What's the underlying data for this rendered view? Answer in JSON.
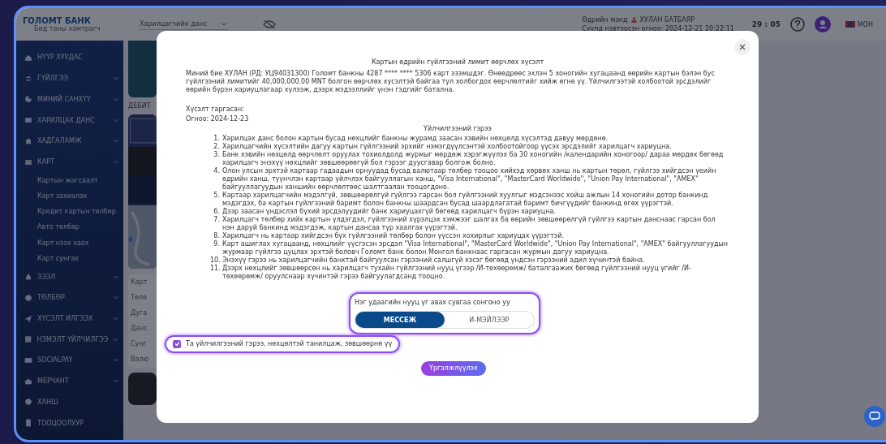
{
  "header": {
    "logo": "ГОЛОМТ БАНК",
    "tagline": "Бид таны хамтрагч",
    "account_select": {
      "placeholder": "Харилцагчийн данс"
    },
    "greeting": "Өдрийн мэнд",
    "user_name": "ХУЛАН БАТБАЯР",
    "last_login": "Сүүлд нэвтэрсэн огноо: 2024-12-21 20:22:11",
    "timer": "29 : 05",
    "language": "МОН"
  },
  "sidebar": {
    "items": [
      {
        "label": "НҮҮР ХУУДАС"
      },
      {
        "label": "ГҮЙЛГЭЭ",
        "expanded": false
      },
      {
        "label": "МИНИЙ САНХҮҮ",
        "expanded": false
      },
      {
        "label": "ХАРИЛЦАХ ДАНС",
        "expanded": false
      },
      {
        "label": "ХАДГАЛАМЖ",
        "expanded": false
      },
      {
        "label": "КАРТ",
        "expanded": true,
        "children": [
          {
            "label": "Картын жагсаалт"
          },
          {
            "label": "Карт захиалах"
          },
          {
            "label": "Кредит картын төлбөр"
          },
          {
            "label": "Авто төлбөр"
          },
          {
            "label": "Карт нээх хаах"
          },
          {
            "label": "Карт сунгах"
          }
        ]
      },
      {
        "label": "ЗЭЭЛ",
        "expanded": false
      },
      {
        "label": "ТӨЛБӨР",
        "expanded": false
      },
      {
        "label": "ХҮСЭЛТ ИЛГЭЭХ",
        "expanded": false
      },
      {
        "label": "НЭМЭЛТ ҮЙЛЧИЛГЭЭ",
        "expanded": false
      },
      {
        "label": "SOCIALPAY",
        "expanded": false
      },
      {
        "label": "МЕРЧАНТ",
        "expanded": false
      },
      {
        "label": "ХАНШ"
      },
      {
        "label": "ТООЦООЛУУР"
      }
    ]
  },
  "content": {
    "section_title": "ДЕБИТ",
    "card_details": [
      "Карт",
      "Төлө",
      "Дуга",
      "Данс",
      "Сунг",
      "Валю"
    ]
  },
  "modal": {
    "title": "Картын өдрийн гүйлгээний лимит өөрчлөх хүсэлт",
    "request_text": "Миний бие ХУЛАН (РД: УЦ94031300) Голомт банкны 4287 **** **** 5306 карт эзэмшдэг. Өнөөдрөөс эхлэн 5 хоногийн хугацаанд өөрийн картын бэлэн бус гүйлгээний лимитийг 40,000,000.00 MNT болгон өөрчлөх хүсэлтэй байгаа тул холбогдох өөрчлөлтийг хийж өгнө үү. Үйлчилгээтэй холбоотой эрсдэлийг өөрийн бүрэн хариуцлагаар хүлээж, дээрх мэдээллийг үнэн гэдгийг батална.",
    "requester": "Хүсэлт гаргасан:",
    "date": "Огноо: 2024-12-23",
    "terms_title": "Үйлчилгээний гэрээ",
    "terms": [
      {
        "number": "1.",
        "text": "Харилцах данс болон картын бусад нөхцлийг банкны журамд заасан хэвийн нөхцөлд хүсэлтэд давуу мөрдөнө."
      },
      {
        "number": "2.",
        "text": "Харилцагчийн хүсэлтийн дагуу картын гүйлгээний эрхийг нэмэгдүүлсэнтэй холбоотойгоор үүсэх эрсдэлийг харилцагч хариуцна."
      },
      {
        "number": "3.",
        "text": "Банк хэвийн нөхцөлд өөрчлөлт оруулах тохиолдолд журмыг мөрдөж хэрэгжүүлэх ба 30 хоногийн /календарийн хоногоор/ дараа мөрдөх бөгөөд харилцагч энэхүү нөхцлийг зөвшөөрөөгүй бол гэрээг дуусгавар болгож болно."
      },
      {
        "number": "4.",
        "text": "Олон улсын эрхтэй картаар гадаадын орнуудад бусад валютаар төлбөр тооцоо хийхэд хөрвөх ханш нь картын төрөл, гүйлгээ хийгдсэн үеийн өдрийн ханш, түүнчлэн картаар үйлчлэх байгууллагын ханш, \"Visa International\", \"MasterCard Worldwide\", \"Union Pay International\", \"AMEX\" байгууллагуудын ханшийн өөрчлөлтөөс шалтгаалан тооцогдоно."
      },
      {
        "number": "5.",
        "text": "Картаар харилцагчийн мэдэлгүй, зөвшөөрөлгүй гүйлгээ гарсан бол гүйлгээний хуулгыг мэдсэнээс хойш ажлын 14 хоногийн дотор банкинд мэдэгдэх, ба картын гүйлгээний баримт болон банкны шаардсан бусад шаардлагатай баримт бичгүүдийг банкинд өгөх үүрэгтэй."
      },
      {
        "number": "6.",
        "text": "Дээр заасан үндэслэл бүхий эрсдэлүүдийг банк хариуцахгүй бөгөөд харилцагч бүрэн хариуцна."
      },
      {
        "number": "7.",
        "text": "Харилцагч төлбөр хийх картын үлдэгдэл, гүйлгээний хүрэлцэх хэмжээг шалгах ба өөрийн зөвшөөрөлгүй гүйлгээ картын данснаас гарсан бол нэн даруй банкинд мэдэгдэж, картын дансаа түр хаалгах үүрэгтэй."
      },
      {
        "number": "8.",
        "text": "Харилцагч нь картаар хийгдсэн бүх гүйлгээний төлбөр болон үүссэн хохирлыг хариуцах үүрэгтэй."
      },
      {
        "number": "9.",
        "text": "Карт ашиглах хугацаанд, нөхцлийг үүсгэсэн эрсдэл \"Visa International\", \"MasterCard Worldwide\", \"Union Pay International\", \"AMEX\" байгууллагуудын журмаар гүйлгээ цуцлах эрхтэй боловч Голомт банк болон Монгол банкнаас гаргасан журмын дагуу хариуцна."
      },
      {
        "number": "10.",
        "text": "Энэхүү гэрээ нь харилцагчийн банктай байгуулсан гэрээний салшгүй хэсэг бөгөөд үндсэн гэрээний адил хүчинтэй байна."
      },
      {
        "number": "11.",
        "text": "Дээрх нөхцлийг зөвшөөрсөн нь харилцагч тухайн гүйлгээний нууц үгээр /И-төхөөрөмж/ баталгаажих бөгөөд гүйлгээний нууц үгийг /И-төхөөрөмж/ оруулснаар хүчинтэй гэрээ байгуулагдсанд тооцно."
      }
    ],
    "otp_prompt": "Нэг удаагийн нууц үг авах сувгаа сонгоно уу",
    "otp_channels": [
      {
        "label": "МЕССЕЖ",
        "selected": true
      },
      {
        "label": "И-МЭЙЛЭЭР",
        "selected": false
      }
    ],
    "agreement": {
      "label": "Та үйлчилгээний гэрээ, нөхцөлтэй танилцаж, зөвшөөрнө үү",
      "checked": true
    },
    "continue_button": "Үргэлжлүүлэх"
  }
}
